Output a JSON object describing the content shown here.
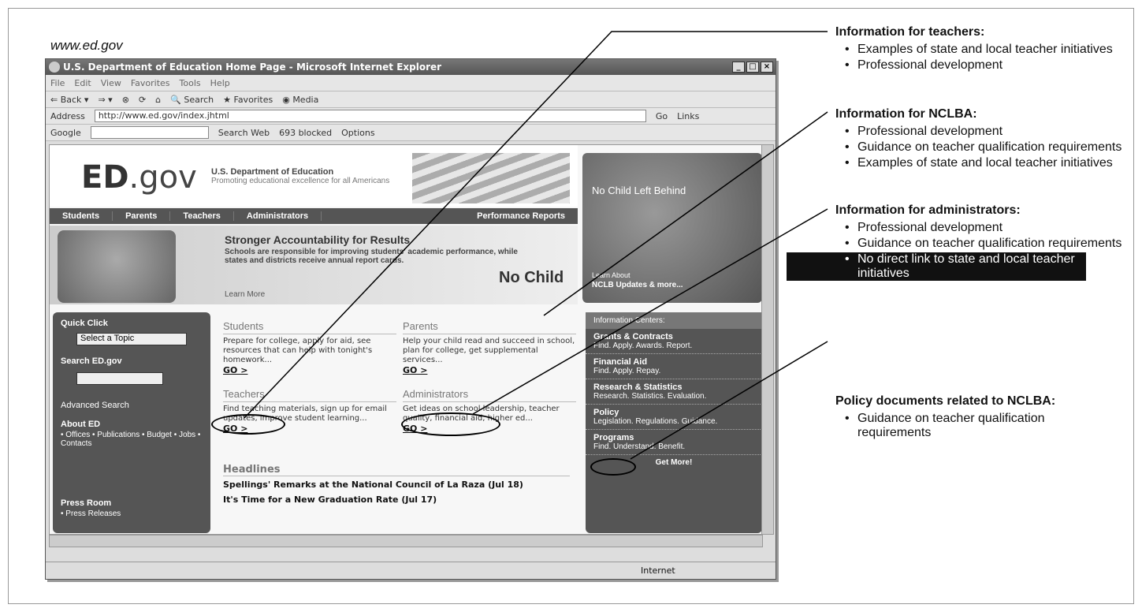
{
  "caption": "www.ed.gov",
  "window": {
    "title": "U.S. Department of Education Home Page - Microsoft Internet Explorer"
  },
  "menu": [
    "File",
    "Edit",
    "View",
    "Favorites",
    "Tools",
    "Help"
  ],
  "toolbar": {
    "back": "Back",
    "search": "Search",
    "favorites": "Favorites",
    "media": "Media"
  },
  "address": {
    "label": "Address",
    "url": "http://www.ed.gov/index.jhtml",
    "go": "Go",
    "links": "Links"
  },
  "google": {
    "label": "Google",
    "search_web": "Search Web",
    "blocked": "693 blocked",
    "options": "Options"
  },
  "site": {
    "logo": "ED",
    "logo_suffix": ".gov",
    "dept": "U.S. Department of Education",
    "tagline": "Promoting educational excellence for all Americans",
    "nav": [
      "Students",
      "Parents",
      "Teachers",
      "Administrators"
    ],
    "nav_right": "Performance Reports",
    "banner_title": "Stronger Accountability for Results",
    "banner_text": "Schools are responsible for improving students' academic performance, while states and districts receive annual report cards.",
    "banner_more": "Learn More",
    "nclb_logo": "No Child",
    "nclb_photo_title": "No Child Left Behind",
    "nclb_learn": "Learn About",
    "nclb_updates": "NCLB Updates & more...",
    "quick_click": "Quick Click",
    "select_topic": "Select a Topic",
    "search_ed": "Search ED.gov",
    "go": "GO",
    "advanced": "Advanced Search",
    "about": "About ED",
    "about_items": "• Offices • Publications • Budget • Jobs • Contacts",
    "press": "Press Room",
    "press_item": "• Press Releases",
    "blocks": [
      {
        "h": "Students",
        "t": "Prepare for college, apply for aid, see resources that can help with tonight's homework...",
        "go": "GO >"
      },
      {
        "h": "Parents",
        "t": "Help your child read and succeed in school, plan for college, get supplemental services...",
        "go": "GO >"
      },
      {
        "h": "Teachers",
        "t": "Find teaching materials, sign up for email updates, improve student learning...",
        "go": "GO >"
      },
      {
        "h": "Administrators",
        "t": "Get ideas on school leadership, teacher quality, financial aid, higher ed...",
        "go": "GO >"
      }
    ],
    "headlines_title": "Headlines",
    "headlines": [
      "Spellings' Remarks at the National Council of La Raza (Jul 18)",
      "It's Time for a New Graduation Rate (Jul 17)"
    ],
    "info_title": "Information Centers:",
    "info": [
      {
        "h": "Grants & Contracts",
        "t": "Find. Apply. Awards. Report."
      },
      {
        "h": "Financial Aid",
        "t": "Find. Apply. Repay."
      },
      {
        "h": "Research & Statistics",
        "t": "Research. Statistics. Evaluation."
      },
      {
        "h": "Policy",
        "t": "Legislation. Regulations. Guidance."
      },
      {
        "h": "Programs",
        "t": "Find. Understand. Benefit."
      }
    ],
    "get_more": "Get More!",
    "status": "Internet"
  },
  "annotations": [
    {
      "title": "Information for teachers:",
      "items": [
        "Examples of state and local teacher initiatives",
        "Professional development"
      ]
    },
    {
      "title": "Information for NCLBA:",
      "items": [
        "Professional development",
        "Guidance on teacher qualification requirements",
        "Examples of state and local teacher initiatives"
      ]
    },
    {
      "title": "Information for administrators:",
      "items": [
        "Professional development",
        "Guidance on teacher qualification requirements",
        "No direct link to state and local teacher initiatives"
      ]
    },
    {
      "title": "Policy documents related to NCLBA:",
      "items": [
        "Guidance on teacher qualification requirements"
      ]
    }
  ]
}
